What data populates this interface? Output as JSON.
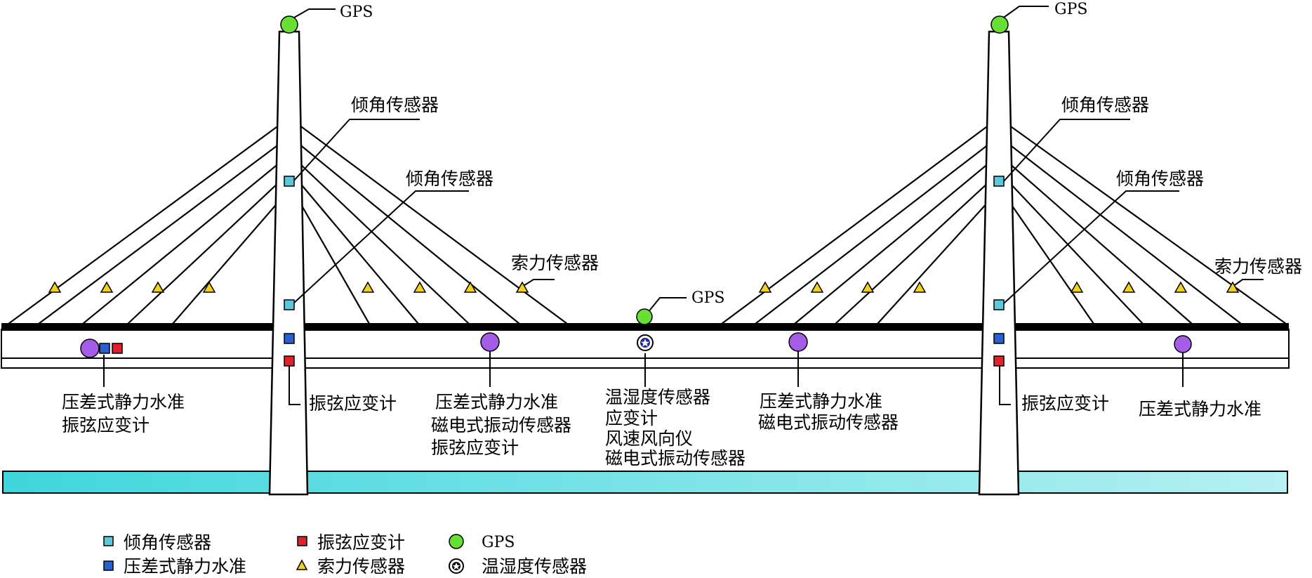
{
  "labels": {
    "gps": "GPS",
    "tilt": "倾角传感器",
    "cable_force": "索力传感器",
    "vibrating_wire": "振弦应变计",
    "static_level": "压差式静力水准",
    "magnetic_vib": "磁电式振动传感器",
    "temp_humidity": "温湿度传感器",
    "strain": "应变计",
    "anemometer": "风速风向仪"
  },
  "legend": [
    {
      "symbol": "tilt",
      "label": "倾角传感器"
    },
    {
      "symbol": "static_level",
      "label": "压差式静力水准"
    },
    {
      "symbol": "vibrating_wire",
      "label": "振弦应变计"
    },
    {
      "symbol": "cable_force",
      "label": "索力传感器"
    },
    {
      "symbol": "gps",
      "label": "GPS"
    },
    {
      "symbol": "temp_humidity",
      "label": "温湿度传感器"
    }
  ],
  "colors": {
    "tilt": "#5bc8dc",
    "static_level": "#2a5fd0",
    "vibrating_wire": "#e0202a",
    "cable_force": "#f2d21e",
    "gps": "#66e033",
    "static_level_circle": "#a55ce6",
    "temp_humidity": "#1e2f8f",
    "water_left": "#3fd6dc",
    "water_right": "#b6f0f2"
  }
}
